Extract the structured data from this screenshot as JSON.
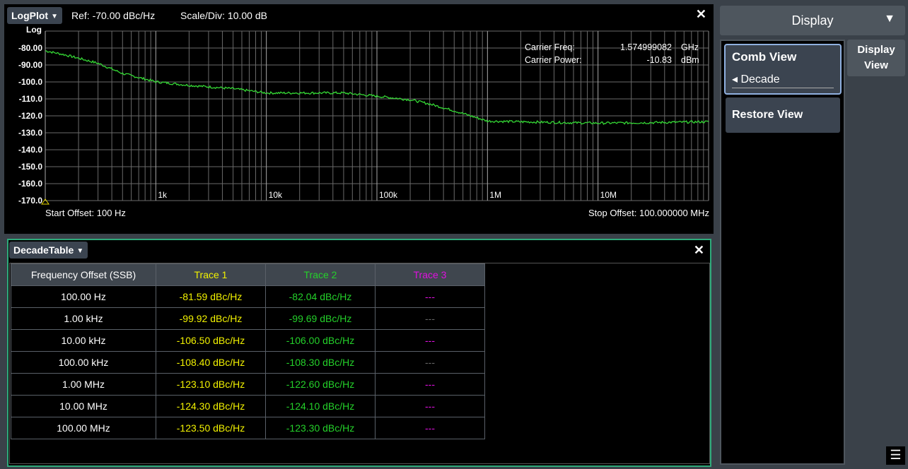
{
  "plot": {
    "menu_label": "LogPlot",
    "ref_text": "Ref: -70.00 dBc/Hz",
    "scale_text": "Scale/Div: 10.00 dB",
    "close": "✕",
    "start_offset": "Start Offset: 100 Hz",
    "stop_offset": "Stop Offset: 100.000000 MHz",
    "carrier": {
      "freq_label": "Carrier Freq:",
      "freq_value": "1.574999082",
      "freq_unit": "GHz",
      "power_label": "Carrier Power:",
      "power_value": "-10.83",
      "power_unit": "dBm"
    }
  },
  "chart_data": {
    "type": "line",
    "xscale": "log",
    "xlim": [
      100,
      100000000
    ],
    "ylim": [
      -170,
      -70
    ],
    "y_axis_title": "Log",
    "y_ticks": [
      "-80.00",
      "-90.00",
      "-100.0",
      "-110.0",
      "-120.0",
      "-130.0",
      "-140.0",
      "-150.0",
      "-160.0",
      "-170.0"
    ],
    "x_tick_labels": [
      "1k",
      "10k",
      "100k",
      "1M",
      "10M"
    ],
    "grid": true,
    "series": [
      {
        "color": "#35d935",
        "x": [
          100,
          150,
          200,
          300,
          500,
          1000,
          2000,
          5000,
          10000,
          20000,
          50000,
          100000,
          200000,
          300000,
          500000,
          1000000,
          2000000,
          5000000,
          10000000,
          30000000,
          100000000
        ],
        "y": [
          -81.6,
          -84,
          -86,
          -89,
          -95,
          -99.9,
          -102,
          -104,
          -106.5,
          -106.5,
          -106.5,
          -108.4,
          -110.5,
          -113,
          -117,
          -123.1,
          -123.5,
          -124,
          -124.3,
          -124,
          -123.5
        ]
      }
    ]
  },
  "table": {
    "menu_label": "DecadeTable",
    "close": "✕",
    "headers": [
      "Frequency Offset (SSB)",
      "Trace 1",
      "Trace 2",
      "Trace 3"
    ],
    "rows": [
      [
        "100.00 Hz",
        "-81.59 dBc/Hz",
        "-82.04 dBc/Hz",
        "---"
      ],
      [
        "1.00 kHz",
        "-99.92 dBc/Hz",
        "-99.69 dBc/Hz",
        "---"
      ],
      [
        "10.00 kHz",
        "-106.50 dBc/Hz",
        "-106.00 dBc/Hz",
        "---"
      ],
      [
        "100.00 kHz",
        "-108.40 dBc/Hz",
        "-108.30 dBc/Hz",
        "---"
      ],
      [
        "1.00 MHz",
        "-123.10 dBc/Hz",
        "-122.60 dBc/Hz",
        "---"
      ],
      [
        "10.00 MHz",
        "-124.30 dBc/Hz",
        "-124.10 dBc/Hz",
        "---"
      ],
      [
        "100.00 MHz",
        "-123.50 dBc/Hz",
        "-123.30 dBc/Hz",
        "---"
      ]
    ]
  },
  "panel": {
    "title": "Display",
    "tab_line1": "Display",
    "tab_line2": "View",
    "comb_view_label": "Comb View",
    "comb_view_value": "◂ Decade",
    "restore_view_label": "Restore View"
  }
}
